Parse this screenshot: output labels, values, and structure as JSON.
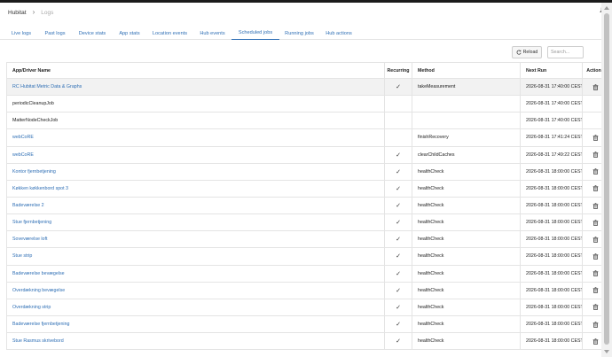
{
  "breadcrumb": {
    "root": "Hubitat",
    "separator": ">",
    "current": "Logs"
  },
  "tabs": [
    {
      "label": "Live logs",
      "active": false
    },
    {
      "label": "Past logs",
      "active": false
    },
    {
      "label": "Device stats",
      "active": false
    },
    {
      "label": "App stats",
      "active": false
    },
    {
      "label": "Location events",
      "active": false
    },
    {
      "label": "Hub events",
      "active": false
    },
    {
      "label": "Scheduled jobs",
      "active": true
    },
    {
      "label": "Running jobs",
      "active": false
    },
    {
      "label": "Hub actions",
      "active": false
    }
  ],
  "toolbar": {
    "reload_label": "Reload",
    "search_placeholder": "Search..."
  },
  "table": {
    "headers": {
      "name": "App/Driver Name",
      "recurring": "Recurring",
      "method": "Method",
      "next_run": "Next Run",
      "actions": "Actions"
    },
    "rows": [
      {
        "name": "RC Hubitat Metric Data & Graphs",
        "link": true,
        "recurring": true,
        "method": "takeMeasurement",
        "next_run": "2026-08-31 17:40:00 CEST",
        "delete": true
      },
      {
        "name": "periodicCleanupJob",
        "link": false,
        "recurring": false,
        "method": "",
        "next_run": "2026-08-31 17:40:00 CEST",
        "delete": false
      },
      {
        "name": "MatterNodeCheckJob",
        "link": false,
        "recurring": false,
        "method": "",
        "next_run": "2026-08-31 17:40:00 CEST",
        "delete": false
      },
      {
        "name": "webCoRE",
        "link": true,
        "recurring": false,
        "method": "finishRecovery",
        "next_run": "2026-08-31 17:41:24 CEST",
        "delete": true
      },
      {
        "name": "webCoRE",
        "link": true,
        "recurring": true,
        "method": "clearChildCaches",
        "next_run": "2026-08-31 17:49:22 CEST",
        "delete": true
      },
      {
        "name": "Kontor fjernbetjening",
        "link": true,
        "recurring": true,
        "method": "healthCheck",
        "next_run": "2026-08-31 18:00:00 CEST",
        "delete": true
      },
      {
        "name": "Køkken køkkenbord spot 3",
        "link": true,
        "recurring": true,
        "method": "healthCheck",
        "next_run": "2026-08-31 18:00:00 CEST",
        "delete": true
      },
      {
        "name": "Badeværelse 2",
        "link": true,
        "recurring": true,
        "method": "healthCheck",
        "next_run": "2026-08-31 18:00:00 CEST",
        "delete": true
      },
      {
        "name": "Stue fjernbetjening",
        "link": true,
        "recurring": true,
        "method": "healthCheck",
        "next_run": "2026-08-31 18:00:00 CEST",
        "delete": true
      },
      {
        "name": "Soveværelse loft",
        "link": true,
        "recurring": true,
        "method": "healthCheck",
        "next_run": "2026-08-31 18:00:00 CEST",
        "delete": true
      },
      {
        "name": "Stue strip",
        "link": true,
        "recurring": true,
        "method": "healthCheck",
        "next_run": "2026-08-31 18:00:00 CEST",
        "delete": true
      },
      {
        "name": "Badeværelse bevægelse",
        "link": true,
        "recurring": true,
        "method": "healthCheck",
        "next_run": "2026-08-31 18:00:00 CEST",
        "delete": true
      },
      {
        "name": "Overdækning bevægelse",
        "link": true,
        "recurring": true,
        "method": "healthCheck",
        "next_run": "2026-08-31 18:00:00 CEST",
        "delete": true
      },
      {
        "name": "Overdækning strip",
        "link": true,
        "recurring": true,
        "method": "healthCheck",
        "next_run": "2026-08-31 18:00:00 CEST",
        "delete": true
      },
      {
        "name": "Badeværelse fjernbetjening",
        "link": true,
        "recurring": true,
        "method": "healthCheck",
        "next_run": "2026-08-31 18:00:00 CEST",
        "delete": true
      },
      {
        "name": "Stue Rasmus skrivebord",
        "link": true,
        "recurring": true,
        "method": "healthCheck",
        "next_run": "2026-08-31 18:00:00 CEST",
        "delete": true
      }
    ]
  },
  "colors": {
    "link": "#2f6fb5",
    "header_strip": "#1b1b1b",
    "first_row_bg": "#f2f2f2"
  },
  "icons": {
    "breadcrumb_separator": "chevron-right-icon",
    "notifications": "bell-icon",
    "reload": "reload-icon",
    "recurring": "check-icon",
    "delete": "trash-icon"
  }
}
